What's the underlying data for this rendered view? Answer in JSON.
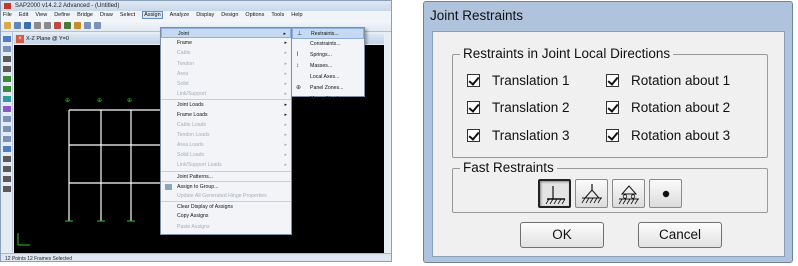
{
  "sap": {
    "title": "SAP2000 v14.2.2 Advanced  - (Untitled)",
    "menu": [
      "File",
      "Edit",
      "View",
      "Define",
      "Bridge",
      "Draw",
      "Select",
      "Assign",
      "Analyze",
      "Display",
      "Design",
      "Options",
      "Tools",
      "Help"
    ],
    "view_title": "X-Z Plane @ Y=0",
    "status": "12 Points  12 Frames Selected",
    "assign_menu": [
      {
        "label": "Joint",
        "arrow": "▸",
        "state": "hl"
      },
      {
        "label": "Frame",
        "arrow": "▸",
        "state": ""
      },
      {
        "label": "Cable",
        "arrow": "▸",
        "state": "dis"
      },
      {
        "label": "Tendon",
        "arrow": "▸",
        "state": "dis"
      },
      {
        "label": "Area",
        "arrow": "▸",
        "state": "dis"
      },
      {
        "label": "Solid",
        "arrow": "▸",
        "state": "dis"
      },
      {
        "label": "Link/Support",
        "arrow": "▸",
        "state": "dis"
      },
      {
        "label": "Joint Loads",
        "arrow": "▸",
        "state": "sep"
      },
      {
        "label": "Frame Loads",
        "arrow": "▸",
        "state": ""
      },
      {
        "label": "Cable Loads",
        "arrow": "▸",
        "state": "dis"
      },
      {
        "label": "Tendon Loads",
        "arrow": "▸",
        "state": "dis"
      },
      {
        "label": "Area Loads",
        "arrow": "▸",
        "state": "dis"
      },
      {
        "label": "Solid Loads",
        "arrow": "▸",
        "state": "dis"
      },
      {
        "label": "Link/Support Loads",
        "arrow": "▸",
        "state": "dis"
      },
      {
        "label": "Joint Patterns...",
        "arrow": "",
        "state": "sep"
      },
      {
        "label": "Assign to Group...",
        "arrow": "",
        "state": "sepicon"
      },
      {
        "label": "Update All Generated Hinge Properties",
        "arrow": "",
        "state": "dis"
      },
      {
        "label": "Clear Display of Assigns",
        "arrow": "",
        "state": "sep"
      },
      {
        "label": "Copy Assigns",
        "arrow": "",
        "state": ""
      },
      {
        "label": "Paste Assigns",
        "arrow": "",
        "state": "dis"
      }
    ],
    "joint_submenu": [
      {
        "label": "Restraints...",
        "icon": "⊥",
        "state": "hl"
      },
      {
        "label": "Constraints...",
        "icon": "",
        "state": ""
      },
      {
        "label": "Springs...",
        "icon": "⌇",
        "state": ""
      },
      {
        "label": "Masses...",
        "icon": "↕",
        "state": ""
      },
      {
        "label": "Local Axes...",
        "icon": "",
        "state": ""
      },
      {
        "label": "Panel Zones...",
        "icon": "⊕",
        "state": ""
      },
      {
        "label": "Merge Number...",
        "icon": "",
        "state": ""
      }
    ]
  },
  "dialog": {
    "title": "Joint Restraints",
    "group_directions": "Restraints in Joint Local Directions",
    "translation_1": "Translation  1",
    "translation_2": "Translation  2",
    "translation_3": "Translation  3",
    "rotation_1": "Rotation about  1",
    "rotation_2": "Rotation about  2",
    "rotation_3": "Rotation about  3",
    "checked": {
      "translation_1": true,
      "translation_2": true,
      "translation_3": true,
      "rotation_1": true,
      "rotation_2": true,
      "rotation_3": true
    },
    "group_fast": "Fast Restraints",
    "fast_buttons": [
      "fixed-support-icon",
      "pinned-support-icon",
      "roller-support-icon",
      "free-joint-icon"
    ],
    "selected_fast": "fixed-support-icon",
    "ok": "OK",
    "cancel": "Cancel"
  },
  "colors": {
    "dialog_frame": "#afc4dc",
    "structure_lines": "#ffffff",
    "joint_marks": "#28c828",
    "menu_highlight": "#c5d9f3"
  }
}
